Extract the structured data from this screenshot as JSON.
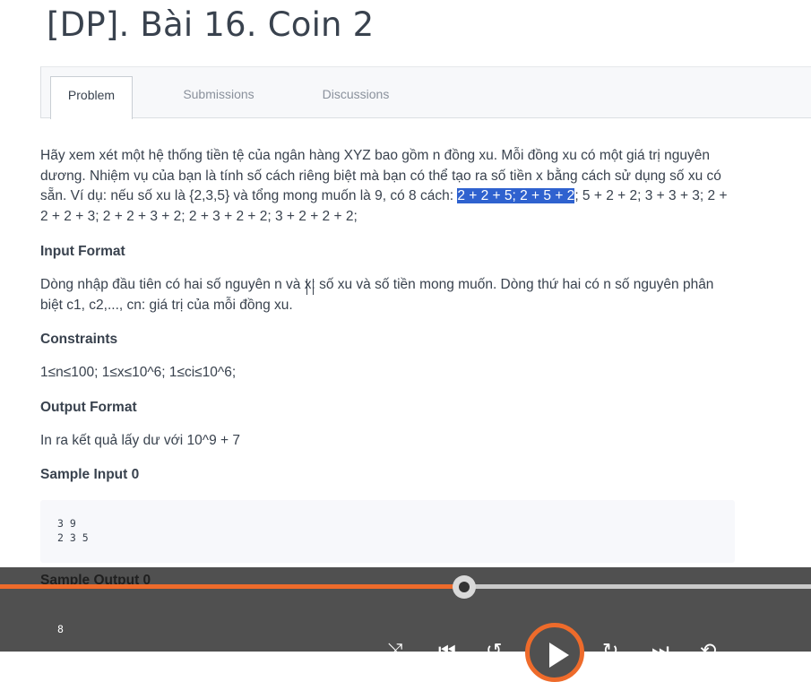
{
  "page": {
    "title": "[DP]. Bài 16. Coin 2"
  },
  "tabs": [
    {
      "label": "Problem",
      "active": true
    },
    {
      "label": "Submissions",
      "active": false
    },
    {
      "label": "Discussions",
      "active": false
    }
  ],
  "problem": {
    "statement_before": "Hãy xem xét một hệ thống tiền tệ của ngân hàng XYZ bao gồm n đồng xu. Mỗi đồng xu có một giá trị nguyên dương. Nhiệm vụ của bạn là tính số cách riêng biệt mà bạn có thể tạo ra số tiền x bằng cách sử dụng số xu có sẵn. Ví dụ: nếu số xu là {2,3,5} và tổng mong muốn là 9, có 8 cách: ",
    "statement_highlight": "2 + 2 + 5; 2 + 5 + 2",
    "statement_after": "; 5 + 2 + 2; 3 + 3 + 3; 2 + 2 + 2 + 3; 2 + 2 + 3 + 2; 2 + 3 + 2 + 2; 3 + 2 + 2 + 2;",
    "input_format_heading": "Input Format",
    "input_format_text": "Dòng nhập đầu tiên có hai số nguyên n và x: số xu và số tiền mong muốn. Dòng thứ hai có n số nguyên phân biệt c1, c2,..., cn: giá trị của mỗi đồng xu.",
    "constraints_heading": "Constraints",
    "constraints_text": "1≤n≤100; 1≤x≤10^6; 1≤ci≤10^6;",
    "output_format_heading": "Output Format",
    "output_format_text": "In ra kết quả lấy dư với 10^9 + 7",
    "sample_input_heading": "Sample Input 0",
    "sample_input": "3 9\n2 3 5",
    "sample_output_heading": "Sample Output 0",
    "sample_output": "8"
  },
  "player": {
    "progress_fraction": 0.572,
    "accent_color": "#ee6b2b",
    "controls": [
      "shuffle-icon",
      "previous-icon",
      "rewind-icon",
      "play-icon",
      "forward-icon",
      "next-icon",
      "repeat-icon"
    ]
  }
}
